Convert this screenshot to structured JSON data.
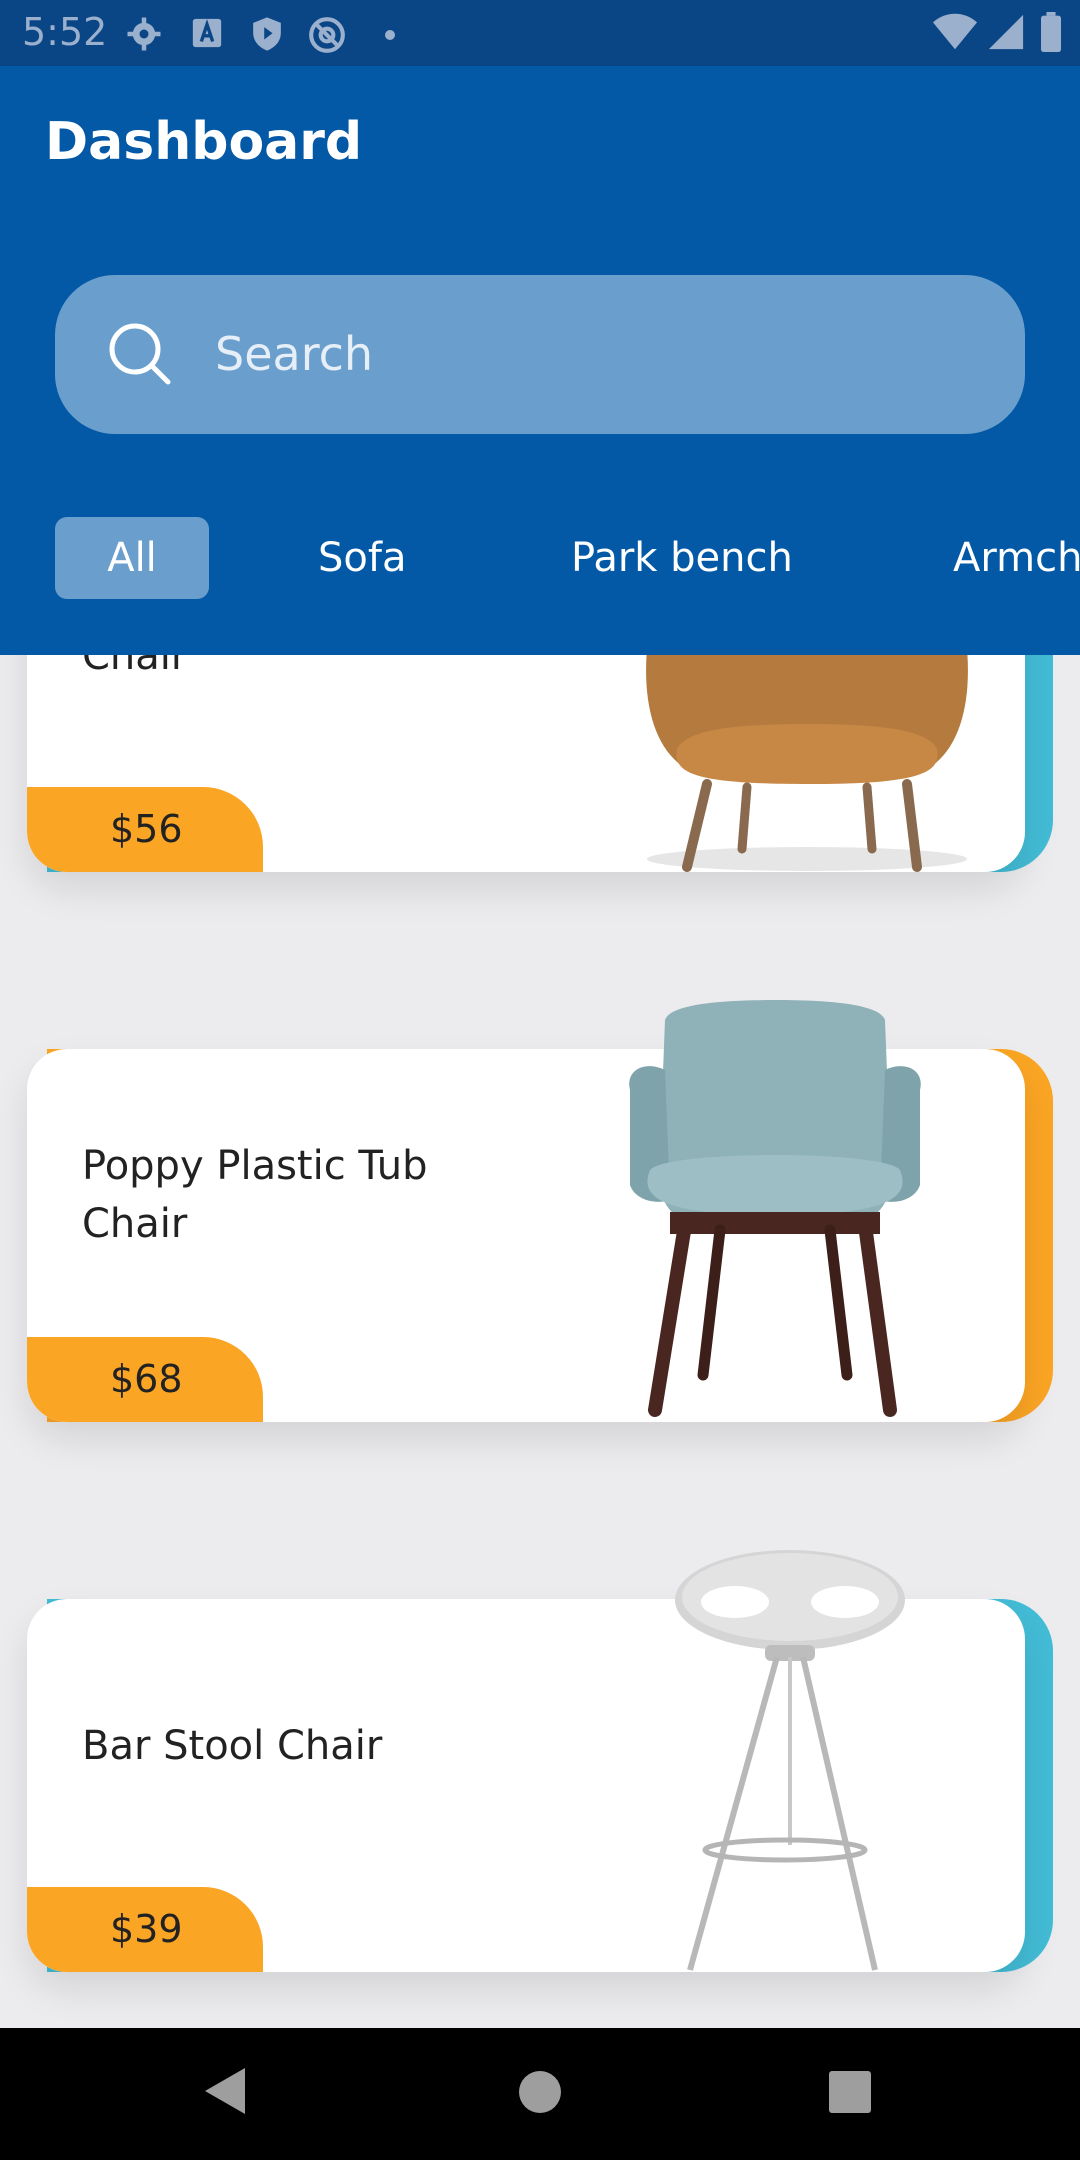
{
  "status_bar": {
    "time": "5:52",
    "left_icons": [
      "gear-icon",
      "a-letter-icon",
      "shield-play-icon",
      "at-sign-icon",
      "dot-icon"
    ],
    "right_icons": [
      "wifi-icon",
      "signal-icon",
      "battery-icon"
    ]
  },
  "header": {
    "title": "Dashboard",
    "background": "#0459A6"
  },
  "search": {
    "placeholder": "Search",
    "icon": "search-icon"
  },
  "tabs": [
    {
      "label": "All",
      "active": true
    },
    {
      "label": "Sofa",
      "active": false
    },
    {
      "label": "Park bench",
      "active": false
    },
    {
      "label": "Armch",
      "active": false
    }
  ],
  "products": [
    {
      "title": "Chair",
      "price": "$56",
      "accent": "#43BCD6",
      "image": "tan-armchair-image"
    },
    {
      "title": "Poppy Plastic Tub Chair",
      "price": "$68",
      "accent": "#FBA524",
      "image": "teal-tub-chair-image"
    },
    {
      "title": "Bar Stool Chair",
      "price": "$39",
      "accent": "#43BCD6",
      "image": "white-bar-stool-image"
    }
  ],
  "colors": {
    "primary": "#0459A6",
    "search_fill": "#6A9FCD",
    "price_tag": "#FBA524",
    "accent_blue": "#43BCD6",
    "list_background": "#ECEBEE"
  },
  "nav_bar": {
    "buttons": [
      "back-icon",
      "home-icon",
      "recents-icon"
    ]
  }
}
